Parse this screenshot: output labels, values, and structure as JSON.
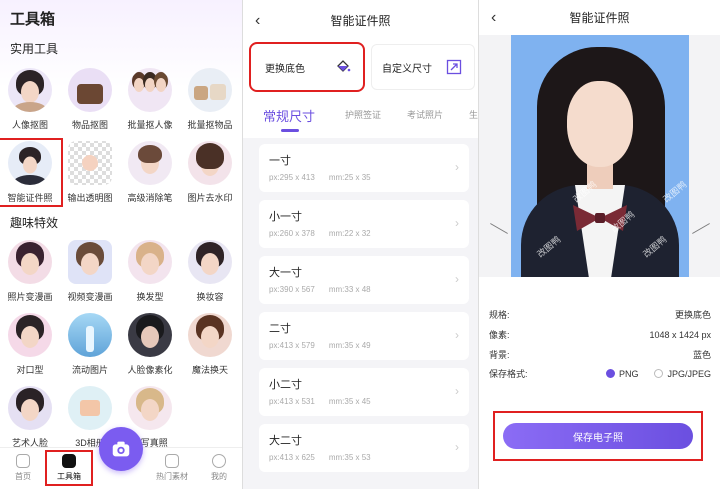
{
  "toolbox": {
    "title": "工具箱",
    "section_practical": "实用工具",
    "practical_tools": [
      {
        "label": "人像抠图",
        "icon": "portrait-icon"
      },
      {
        "label": "物品抠图",
        "icon": "handbag-icon"
      },
      {
        "label": "批量抠人像",
        "icon": "group-portrait-icon"
      },
      {
        "label": "批量抠物品",
        "icon": "bags-icon"
      },
      {
        "label": "智能证件照",
        "icon": "id-photo-icon"
      },
      {
        "label": "输出透明图",
        "icon": "transparent-image-icon"
      },
      {
        "label": "高级消除笔",
        "icon": "eraser-pen-icon"
      },
      {
        "label": "图片去水印",
        "icon": "remove-watermark-icon"
      }
    ],
    "section_fun": "趣味特效",
    "fun_tools": [
      {
        "label": "照片变漫画",
        "icon": "photo-to-comic-icon"
      },
      {
        "label": "视频变漫画",
        "icon": "video-to-comic-icon"
      },
      {
        "label": "换发型",
        "icon": "hairstyle-icon"
      },
      {
        "label": "换妆容",
        "icon": "makeup-icon"
      },
      {
        "label": "对口型",
        "icon": "lip-sync-icon"
      },
      {
        "label": "流动图片",
        "icon": "flowing-image-icon"
      },
      {
        "label": "人脸像素化",
        "icon": "face-pixelate-icon"
      },
      {
        "label": "魔法换天",
        "icon": "sky-replace-icon"
      },
      {
        "label": "艺术人脸",
        "icon": "art-face-icon"
      },
      {
        "label": "3D相册",
        "icon": "album-3d-icon"
      },
      {
        "label": "AI写真照",
        "icon": "ai-portrait-icon"
      }
    ],
    "nav": [
      {
        "label": "首页",
        "icon": "home-icon"
      },
      {
        "label": "工具箱",
        "icon": "toolbox-icon"
      },
      {
        "label": "热门素材",
        "icon": "materials-icon"
      },
      {
        "label": "我的",
        "icon": "profile-icon"
      }
    ]
  },
  "id_photo": {
    "title": "智能证件照",
    "action_change_bg": "更换底色",
    "action_custom_size": "自定义尺寸",
    "tabs": [
      "常规尺寸",
      "护照签证",
      "考试照片",
      "生"
    ],
    "sizes": [
      {
        "name": "一寸",
        "px": "px:295 x 413",
        "mm": "mm:25 x 35"
      },
      {
        "name": "小一寸",
        "px": "px:260 x 378",
        "mm": "mm:22 x 32"
      },
      {
        "name": "大一寸",
        "px": "px:390 x 567",
        "mm": "mm:33 x 48"
      },
      {
        "name": "二寸",
        "px": "px:413 x 579",
        "mm": "mm:35 x 49"
      },
      {
        "name": "小二寸",
        "px": "px:413 x 531",
        "mm": "mm:35 x 45"
      },
      {
        "name": "大二寸",
        "px": "px:413 x 625",
        "mm": "mm:35 x 53"
      }
    ]
  },
  "result": {
    "title": "智能证件照",
    "watermark": "改图鸭",
    "spec_label": "规格:",
    "spec_value": "更换底色",
    "pixels_label": "像素:",
    "pixels_value": "1048 x 1424 px",
    "bg_label": "背景:",
    "bg_value": "蓝色",
    "format_label": "保存格式:",
    "format_png": "PNG",
    "format_jpg": "JPG/JPEG",
    "save_button": "保存电子照"
  },
  "colors": {
    "accent": "#6b4fe0",
    "highlight_box": "#e02020",
    "photo_background": "#7fb2f0"
  }
}
